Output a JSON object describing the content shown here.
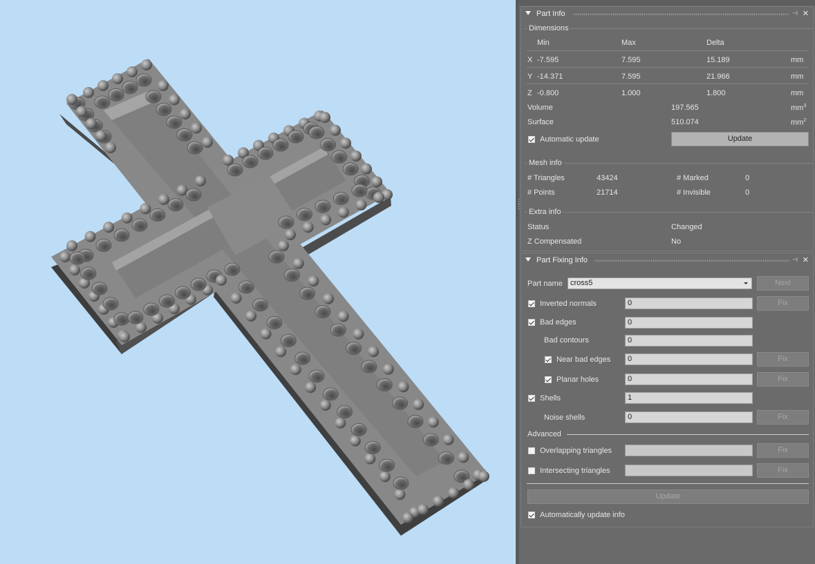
{
  "part_info": {
    "title": "Part Info",
    "dimensions": {
      "label": "Dimensions",
      "headers": [
        "Min",
        "Max",
        "Delta"
      ],
      "rows": [
        {
          "axis": "X",
          "min": "-7.595",
          "max": "7.595",
          "delta": "15.189",
          "unit": "mm"
        },
        {
          "axis": "Y",
          "min": "-14.371",
          "max": "7.595",
          "delta": "21.966",
          "unit": "mm"
        },
        {
          "axis": "Z",
          "min": "-0.800",
          "max": "1.000",
          "delta": "1.800",
          "unit": "mm"
        }
      ],
      "volume_label": "Volume",
      "volume_value": "197.565",
      "volume_unit": "mm",
      "volume_exp": "3",
      "surface_label": "Surface",
      "surface_value": "510.074",
      "surface_unit": "mm",
      "surface_exp": "2",
      "auto_update_label": "Automatic update",
      "auto_update_checked": true,
      "update_button": "Update"
    },
    "mesh_info": {
      "label": "Mesh info",
      "triangles_label": "# Triangles",
      "triangles_value": "43424",
      "points_label": "# Points",
      "points_value": "21714",
      "marked_label": "# Marked",
      "marked_value": "0",
      "invisible_label": "# Invisible",
      "invisible_value": "0"
    },
    "extra_info": {
      "label": "Extra info",
      "status_label": "Status",
      "status_value": "Changed",
      "zcomp_label": "Z Compensated",
      "zcomp_value": "No"
    }
  },
  "part_fixing": {
    "title": "Part Fixing Info",
    "part_name_label": "Part name",
    "part_name_value": "cross5",
    "next_button": "Next",
    "fix_label": "Fix",
    "inverted_normals_label": "Inverted normals",
    "inverted_normals_value": "0",
    "bad_edges_label": "Bad edges",
    "bad_edges_value": "0",
    "bad_contours_label": "Bad contours",
    "bad_contours_value": "0",
    "near_bad_edges_label": "Near bad edges",
    "near_bad_edges_value": "0",
    "planar_holes_label": "Planar holes",
    "planar_holes_value": "0",
    "shells_label": "Shells",
    "shells_value": "1",
    "noise_shells_label": "Noise shells",
    "noise_shells_value": "0",
    "advanced_label": "Advanced",
    "overlapping_label": "Overlapping triangles",
    "intersecting_label": "Intersecting triangles",
    "update_button": "Update",
    "auto_update_info_label": "Automatically update info"
  },
  "colors": {
    "viewport_bg": "#bddcf6",
    "panel_bg": "#6b6b6b",
    "model_gray": "#8c8c8c"
  },
  "icons": [
    "collapse-triangle-icon",
    "pin-icon",
    "close-icon",
    "dropdown-arrow-icon",
    "checkmark-icon",
    "splitter-grip-icon"
  ]
}
